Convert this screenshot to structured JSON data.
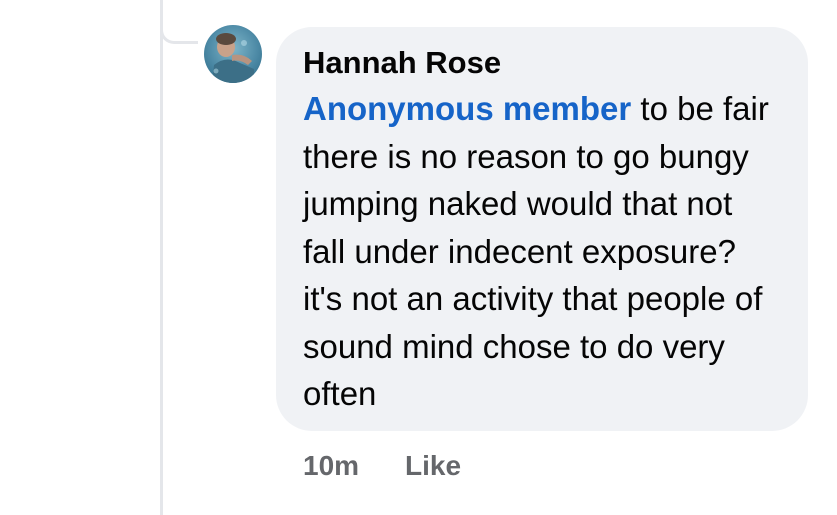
{
  "comment": {
    "author": "Hannah Rose",
    "mention": "Anonymous member",
    "text": " to be fair there is no reason to go bungy jumping naked would that not fall under indecent exposure? it's not an activity that people of sound mind chose to do very often",
    "timestamp": "10m",
    "like_label": "Like"
  },
  "colors": {
    "bubble": "#f0f2f5",
    "mention": "#1664c8",
    "meta": "#65676b",
    "thread_line": "#e4e6ea"
  }
}
